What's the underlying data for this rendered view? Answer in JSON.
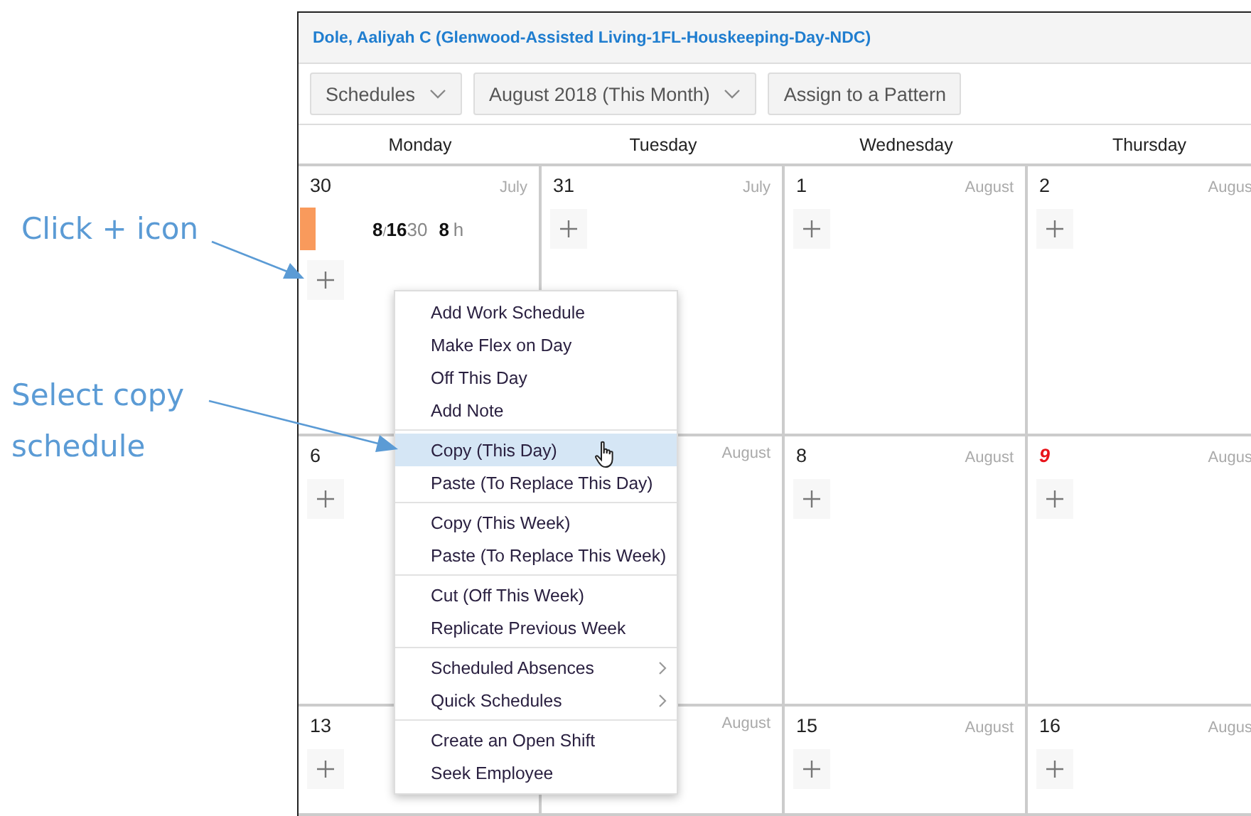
{
  "annotations": [
    {
      "text": "Click + icon"
    },
    {
      "text": "Select copy\nschedule"
    }
  ],
  "employee_title": "Dole, Aaliyah C (Glenwood-Assisted Living-1FL-Houskeeping-Day-NDC)",
  "toolbar": [
    {
      "kind": "dropdown",
      "label": "Schedules"
    },
    {
      "kind": "dropdown",
      "label": "August 2018 (This Month)"
    },
    {
      "kind": "button",
      "label": "Assign to a Pattern"
    }
  ],
  "weekdays": [
    "Monday",
    "Tuesday",
    "Wednesday",
    "Thursday"
  ],
  "weeks": [
    [
      {
        "day": "30",
        "month": "July",
        "today": false,
        "add_button": true,
        "shift": {
          "start": "8",
          "separator": "/",
          "end": "16",
          "end_minutes": "30",
          "hours": "8",
          "unit": "h"
        }
      },
      {
        "day": "31",
        "month": "July",
        "today": false,
        "add_button": true
      },
      {
        "day": "1",
        "month": "August",
        "today": false,
        "add_button": true
      },
      {
        "day": "2",
        "month": "Augus",
        "today": false,
        "add_button": true
      }
    ],
    [
      {
        "day": "6",
        "today": false,
        "add_button": true
      },
      {
        "month": "August"
      },
      {
        "day": "8",
        "month": "August",
        "today": false,
        "add_button": true
      },
      {
        "day": "9",
        "month": "Augus",
        "today": true,
        "add_button": true
      }
    ],
    [
      {
        "day": "13",
        "today": false,
        "add_button": true
      },
      {
        "month": "August"
      },
      {
        "day": "15",
        "month": "August",
        "today": false,
        "add_button": true
      },
      {
        "day": "16",
        "month": "Augus",
        "today": false,
        "add_button": true
      }
    ]
  ],
  "context_menu": [
    [
      {
        "label": "Add Work Schedule",
        "selected": false,
        "submenu": false
      },
      {
        "label": "Make Flex on Day",
        "selected": false,
        "submenu": false
      },
      {
        "label": "Off This Day",
        "selected": false,
        "submenu": false
      },
      {
        "label": "Add Note",
        "selected": false,
        "submenu": false
      }
    ],
    [
      {
        "label": "Copy (This Day)",
        "selected": true,
        "submenu": false
      },
      {
        "label": "Paste (To Replace This Day)",
        "selected": false,
        "submenu": false
      }
    ],
    [
      {
        "label": "Copy (This Week)",
        "selected": false,
        "submenu": false
      },
      {
        "label": "Paste (To Replace This Week)",
        "selected": false,
        "submenu": false
      }
    ],
    [
      {
        "label": "Cut (Off This Week)",
        "selected": false,
        "submenu": false
      },
      {
        "label": "Replicate Previous Week",
        "selected": false,
        "submenu": false
      }
    ],
    [
      {
        "label": "Scheduled Absences",
        "selected": false,
        "submenu": true
      },
      {
        "label": "Quick Schedules",
        "selected": false,
        "submenu": true
      }
    ],
    [
      {
        "label": "Create an Open Shift",
        "selected": false,
        "submenu": false
      },
      {
        "label": "Seek Employee",
        "selected": false,
        "submenu": false
      }
    ]
  ]
}
